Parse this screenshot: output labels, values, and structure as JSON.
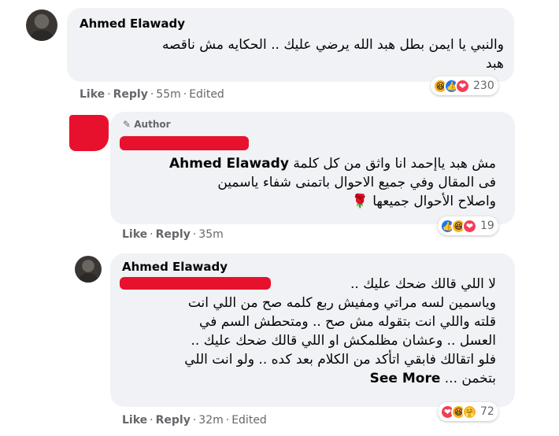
{
  "comment1": {
    "author": "Ahmed Elawady",
    "text_line1": "والنبي يا ايمن بطل هبد الله يرضي عليك .. الحكايه مش ناقصه",
    "text_line2": "هبد",
    "like": "Like",
    "reply": "Reply",
    "time": "55m",
    "edited": "Edited",
    "reaction_count": "230"
  },
  "reply1": {
    "author_tag": "Author",
    "mention": "Ahmed Elawady",
    "text_line1": "مش هبد ياإحمد انا واثق من كل كلمة",
    "text_line2": "فى المقال وفي جميع الاحوال باتمنى شفاء ياسمين",
    "text_line3": "واصلاح الأحوال جميعها",
    "like": "Like",
    "reply": "Reply",
    "time": "35m",
    "reaction_count": "19"
  },
  "reply2": {
    "author": "Ahmed Elawady",
    "text_line1": "لا اللي قالك ضحك عليك ..",
    "text_line2": "وياسمين لسه مراتي ومفيش ربع كلمه صح من اللي انت",
    "text_line3": "قلته واللي انت بتقوله مش صح .. ومتحطش السم في",
    "text_line4": "العسل .. وعشان مظلمكش او اللي قالك ضحك عليك ..",
    "text_line5": "فلو اتقالك فابقي اتأكد من الكلام بعد كده .. ولو انت اللي",
    "text_line6": "بتخمن ...",
    "see_more": "See More",
    "like": "Like",
    "reply": "Reply",
    "time": "32m",
    "edited": "Edited",
    "reaction_count": "72"
  },
  "icons": {
    "haha": "😆",
    "like": "👍",
    "love": "❤",
    "care": "🤗",
    "rose": "🌹",
    "pencil": "✎"
  },
  "colors": {
    "bubble": "#f0f2f5",
    "meta": "#65676b",
    "like_blue": "#1877f2",
    "love_red": "#f33e58",
    "haha_yellow": "#f7b125",
    "redaction": "#e8112d"
  }
}
